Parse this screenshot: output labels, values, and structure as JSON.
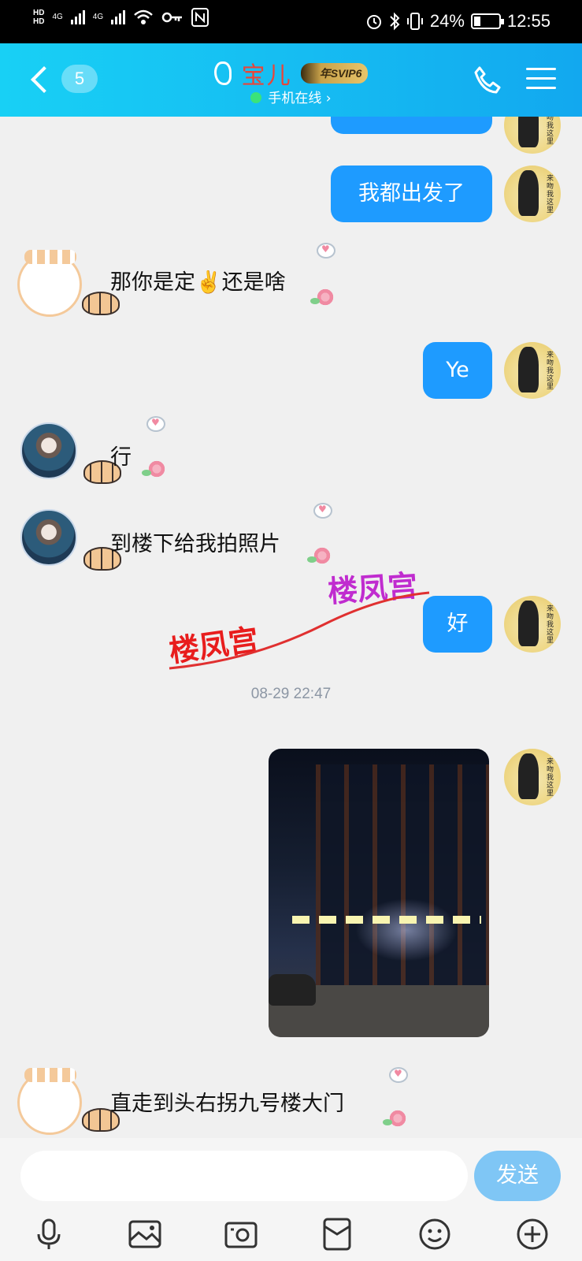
{
  "status_bar": {
    "hd1": "HD",
    "hd2": "HD",
    "net1": "4G",
    "net2": "4G",
    "battery_percent": "24%",
    "time": "12:55"
  },
  "header": {
    "unread_count": "5",
    "contact_name": "宝儿",
    "vip_badge": "年SVIP6",
    "online_status": "手机在线 ›"
  },
  "messages": [
    {
      "side": "me",
      "text": "我都出发了"
    },
    {
      "side": "them",
      "text": "那你是定✌️还是啥"
    },
    {
      "side": "me",
      "text": "Ye"
    },
    {
      "side": "them",
      "text": "行"
    },
    {
      "side": "them",
      "text": "到楼下给我拍照片"
    },
    {
      "side": "me",
      "text": "好"
    },
    {
      "side": "time",
      "text": "08-29 22:47"
    },
    {
      "side": "me",
      "text": "[photo]"
    },
    {
      "side": "them",
      "text": "直走到头右拐九号楼大门"
    }
  ],
  "watermark": {
    "text1": "楼凤宫",
    "text2": "楼凤宫"
  },
  "input": {
    "placeholder": "",
    "send_label": "发送"
  },
  "colors": {
    "header_start": "#18d0f5",
    "header_end": "#12a8ef",
    "bubble_out": "#1e9bff",
    "send_button": "#7fc6f5"
  }
}
